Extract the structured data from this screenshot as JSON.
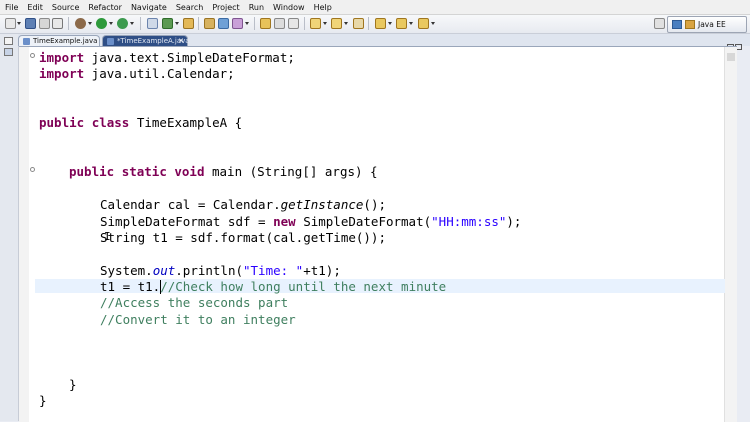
{
  "menu": [
    "File",
    "Edit",
    "Source",
    "Refactor",
    "Navigate",
    "Search",
    "Project",
    "Run",
    "Window",
    "Help"
  ],
  "perspective": {
    "label": "Java EE",
    "icon": "perspective-icon"
  },
  "tabs": [
    {
      "label": "TimeExample.java",
      "active": false
    },
    {
      "label": "*TimeExampleA.java",
      "active": true
    }
  ],
  "code": {
    "l1": {
      "kw": "import",
      "rest": " java.text.SimpleDateFormat;"
    },
    "l2": {
      "kw": "import",
      "rest": " java.util.Calendar;"
    },
    "l3": {
      "kw1": "public",
      "kw2": "class",
      "rest": " TimeExampleA {"
    },
    "l4": {
      "kw1": "public",
      "kw2": "static",
      "kw3": "void",
      "rest": " main (String[] args) {"
    },
    "l5": {
      "a": "Calendar cal = Calendar.",
      "b": "getInstance",
      "c": "();"
    },
    "l6": {
      "a": "SimpleDateFormat sdf = ",
      "kw": "new",
      "b": " SimpleDateFormat(",
      "str": "\"HH:mm:ss\"",
      "c": ");"
    },
    "l7": {
      "text": "String t1 = sdf.format(cal.getTime());"
    },
    "l8": {
      "a": "System.",
      "b": "out",
      "c": ".println(",
      "str": "\"Time: \"",
      "d": "+t1);"
    },
    "l9": {
      "a": "t1 = t1.",
      "cmt": "//Check how long until the next minute"
    },
    "l10": {
      "cmt": "//Access the seconds part"
    },
    "l11": {
      "cmt": "//Convert it to an integer"
    },
    "l12": {
      "text": "}"
    },
    "l13": {
      "text": "}"
    }
  },
  "colors": {
    "keyword": "#7f0055",
    "string": "#2a00ff",
    "comment": "#3f7f5f",
    "field": "#0000c0",
    "current_line": "#e8f2fe"
  },
  "icons": [
    "new-icon",
    "save-icon",
    "print-icon",
    "debug-icon",
    "run-icon",
    "external-tools-icon",
    "new-java-class-icon",
    "open-type-icon",
    "search-icon",
    "back-icon",
    "forward-icon",
    "maximize-icon",
    "minimize-icon"
  ]
}
